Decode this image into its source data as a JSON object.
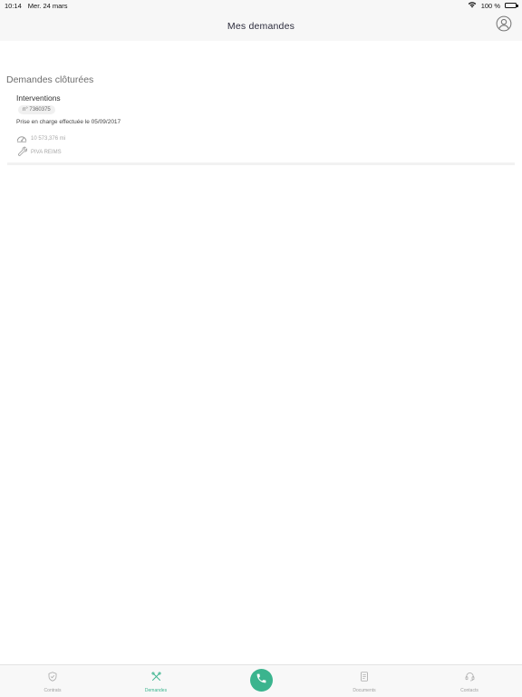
{
  "status_bar": {
    "time": "10:14",
    "date": "Mer. 24 mars",
    "battery_text": "100 %"
  },
  "nav": {
    "title": "Mes demandes"
  },
  "section": {
    "title": "Demandes clôturées"
  },
  "requests": [
    {
      "type": "Interventions",
      "number": "n° 7360375",
      "status": "Prise en charge effectuée le 05/09/2017",
      "mileage": "10 573,376 mi",
      "garage": "PIVA REIMS"
    }
  ],
  "tabs": [
    {
      "label": "Contrats",
      "icon": "shield-icon",
      "active": false
    },
    {
      "label": "Demandes",
      "icon": "tools-icon",
      "active": true
    },
    {
      "label": "",
      "icon": "phone-icon",
      "active": false
    },
    {
      "label": "Documents",
      "icon": "document-icon",
      "active": false
    },
    {
      "label": "Contacts",
      "icon": "headset-icon",
      "active": false
    }
  ],
  "colors": {
    "accent": "#3bb48e",
    "bar_background": "#f7f7f7",
    "muted_text": "#a0a0a0"
  }
}
